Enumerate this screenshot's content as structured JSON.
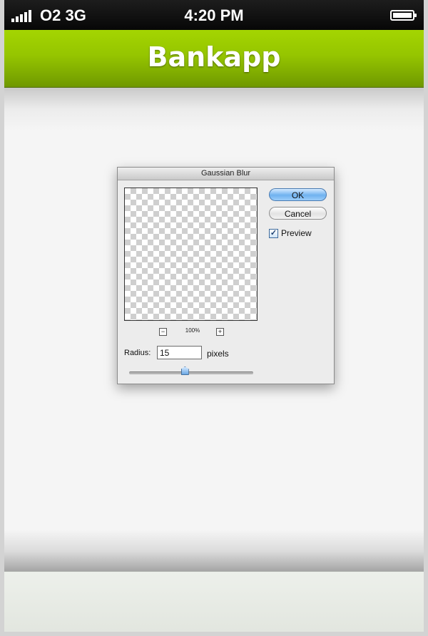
{
  "status_bar": {
    "carrier": "O2  3G",
    "time": "4:20 PM"
  },
  "nav_bar": {
    "title": "Bankapp"
  },
  "dialog": {
    "title": "Gaussian Blur",
    "ok_label": "OK",
    "cancel_label": "Cancel",
    "preview_label": "Preview",
    "preview_checked": true,
    "zoom_minus": "−",
    "zoom_plus": "+",
    "zoom_level": "100%",
    "radius_label": "Radius:",
    "radius_value": "15",
    "radius_unit": "pixels",
    "radius_slider_fraction": 0.45
  },
  "colors": {
    "nav_green": "#95c500",
    "status_bar": "#0a0a0a",
    "ok_button_blue": "#6fb2f0"
  }
}
